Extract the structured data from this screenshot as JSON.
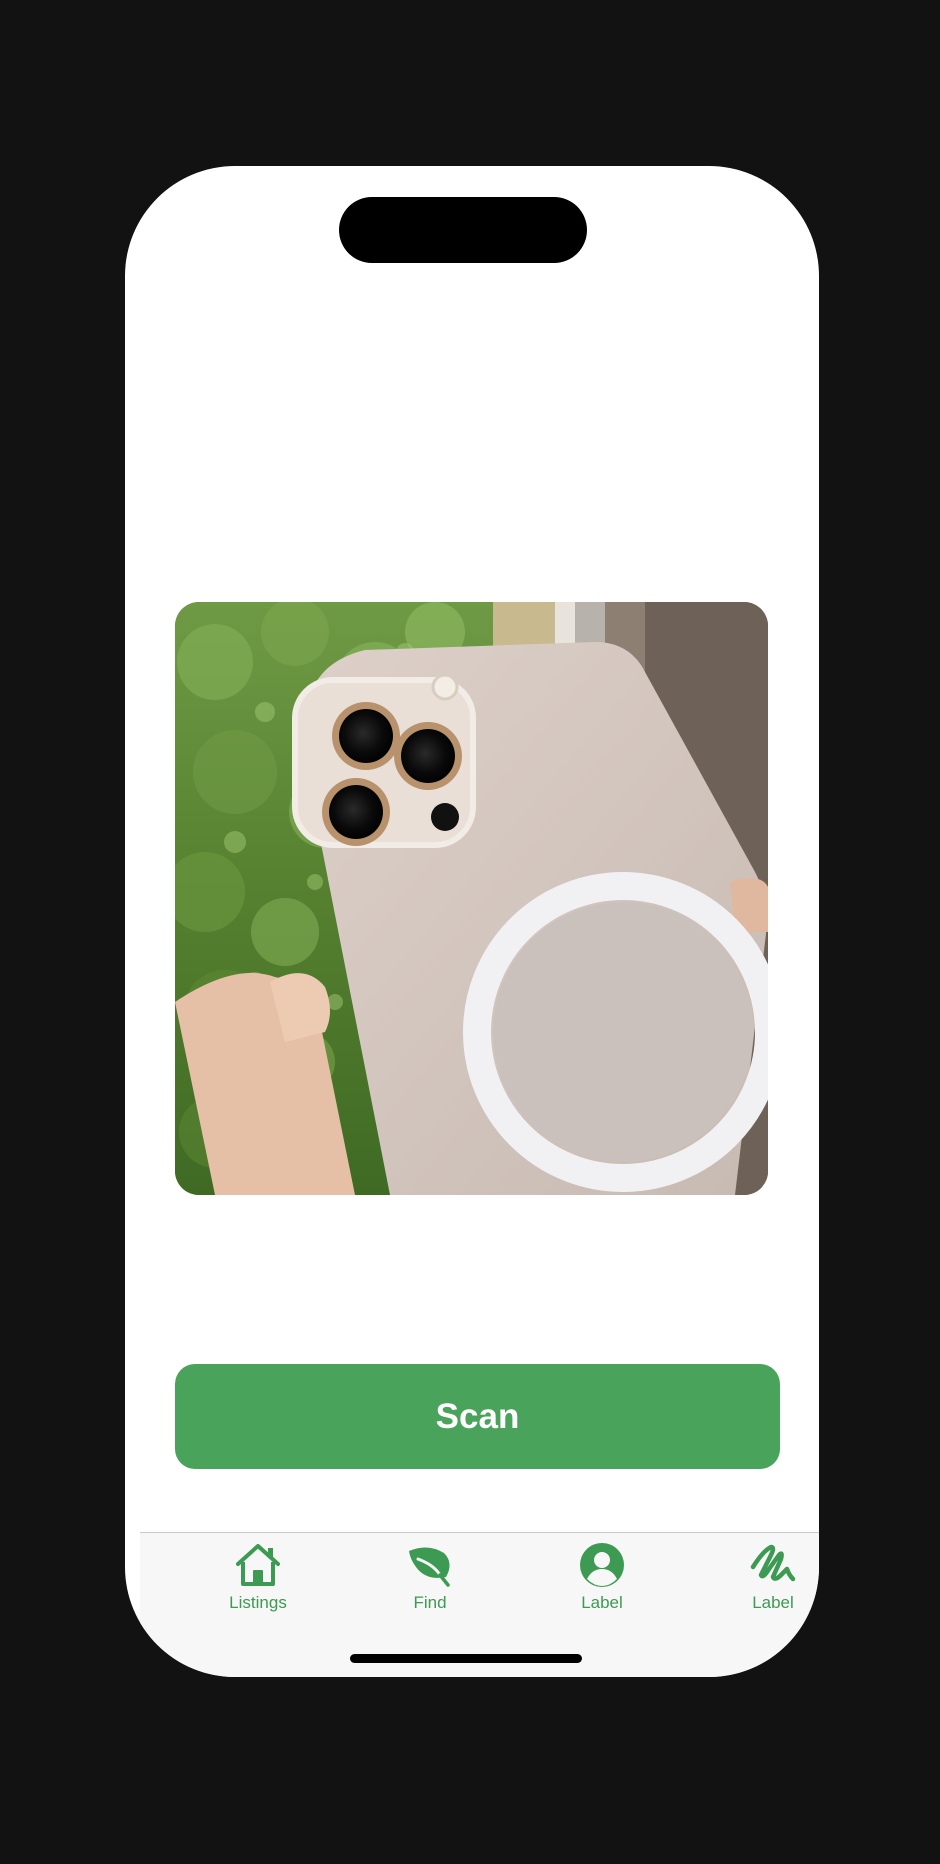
{
  "scan": {
    "label": "Scan"
  },
  "tabs": [
    {
      "label": "Listings",
      "icon": "house-icon"
    },
    {
      "label": "Find",
      "icon": "leaf-icon"
    },
    {
      "label": "Label",
      "icon": "person-circle-icon"
    },
    {
      "label": "Label",
      "icon": "scribble-icon"
    }
  ],
  "colors": {
    "accent": "#49a35a",
    "tab_tint": "#3d9a52",
    "background": "#121212",
    "screen": "#ffffff",
    "tabbar": "#f7f7f7"
  }
}
